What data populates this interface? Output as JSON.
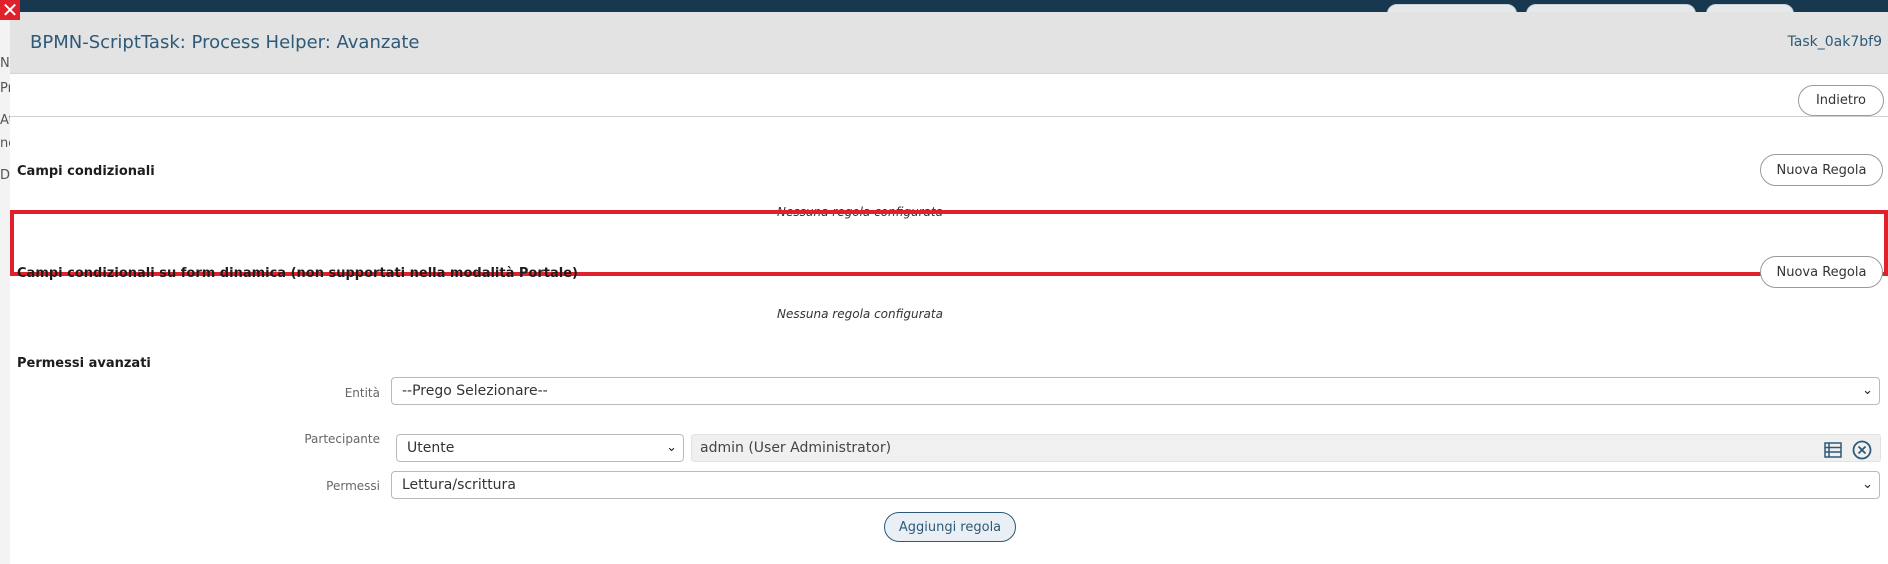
{
  "dialog": {
    "title": "BPMN-ScriptTask: Process Helper: Avanzate",
    "task_id": "Task_0ak7bf9",
    "back_label": "Indietro"
  },
  "background": {
    "left_fragments": [
      "N",
      "Pr",
      "At",
      "no",
      "D"
    ]
  },
  "sections": {
    "conditional": {
      "title": "Campi condizionali",
      "new_rule_label": "Nuova Regola",
      "empty_text": "Nessuna regola configurata"
    },
    "conditional_dynamic": {
      "title": "Campi condizionali su form dinamica (non supportati nella modalità Portale)",
      "new_rule_label": "Nuova Regola",
      "empty_text": "Nessuna regola configurata"
    },
    "permissions": {
      "title": "Permessi avanzati",
      "entity_label": "Entità",
      "entity_value": "--Prego Selezionare--",
      "participant_label": "Partecipante",
      "participant_type": "Utente",
      "participant_value": "admin (User Administrator)",
      "permissions_label": "Permessi",
      "permissions_value": "Lettura/scrittura",
      "add_rule_label": "Aggiungi regola"
    }
  },
  "colors": {
    "accent": "#2d5a78",
    "highlight": "#e0202a",
    "header_bg": "#e3e3e3"
  }
}
